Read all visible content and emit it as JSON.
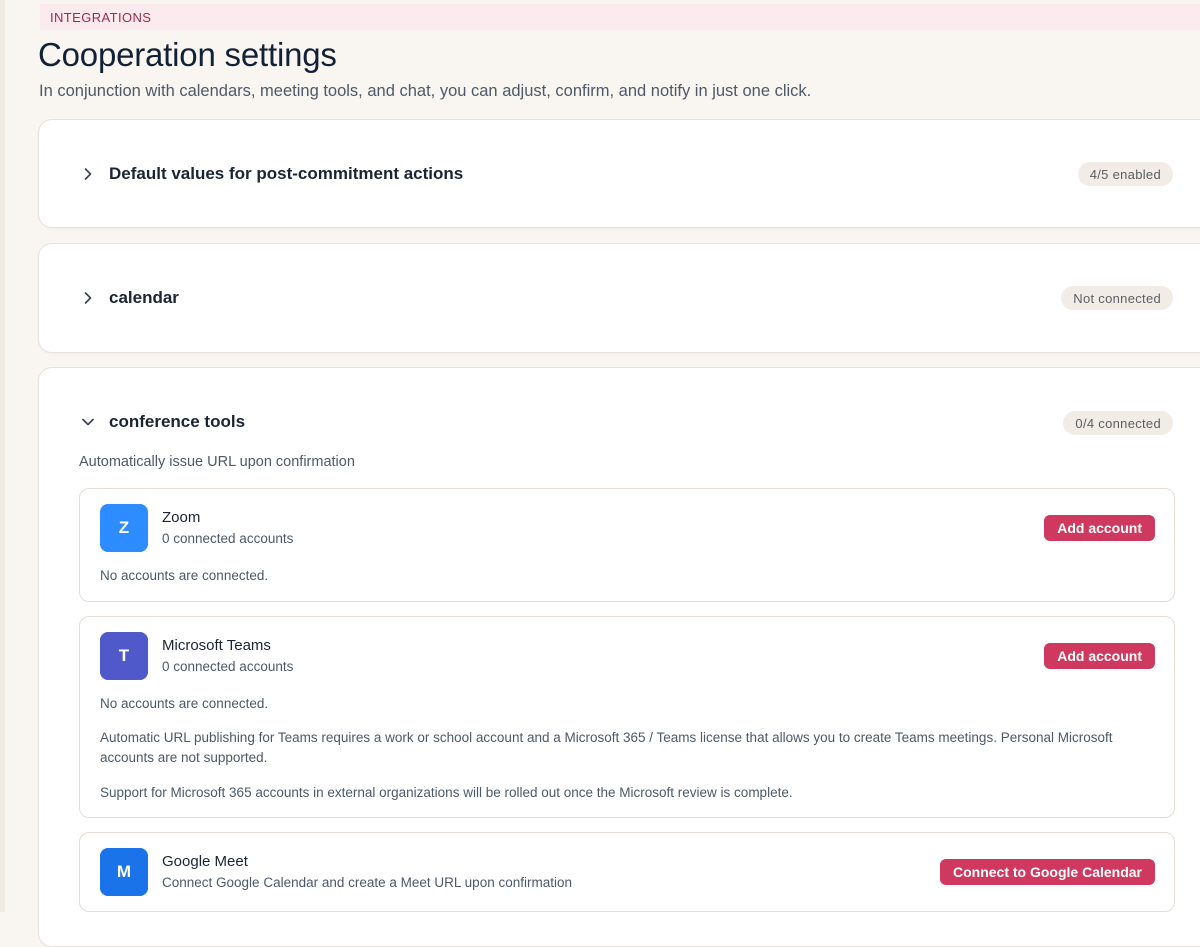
{
  "header": {
    "eyebrow": "INTEGRATIONS",
    "title": "Cooperation settings",
    "subtitle": "In conjunction with calendars, meeting tools, and chat, you can adjust, confirm, and notify in just one click."
  },
  "sections": [
    {
      "title": "Default values for post-commitment actions",
      "status": "4/5 enabled",
      "expanded": false
    },
    {
      "title": "calendar",
      "status": "Not connected",
      "expanded": false
    },
    {
      "title": "conference tools",
      "status": "0/4 connected",
      "expanded": true,
      "description": "Automatically issue URL upon confirmation",
      "tools": [
        {
          "icon_letter": "Z",
          "icon_color": "#2d8cff",
          "name": "Zoom",
          "subtitle": "0 connected accounts",
          "button": "Add account",
          "notes": [
            "No accounts are connected."
          ]
        },
        {
          "icon_letter": "T",
          "icon_color": "#5059c9",
          "name": "Microsoft Teams",
          "subtitle": "0 connected accounts",
          "button": "Add account",
          "notes": [
            "No accounts are connected.",
            "Automatic URL publishing for Teams requires a work or school account and a Microsoft 365 / Teams license that allows you to create Teams meetings. Personal Microsoft accounts are not supported.",
            "Support for Microsoft 365 accounts in external organizations will be rolled out once the Microsoft review is complete."
          ]
        },
        {
          "icon_letter": "M",
          "icon_color": "#1a73e8",
          "name": "Google Meet",
          "subtitle": "Connect Google Calendar and create a Meet URL upon confirmation",
          "button": "Connect to Google Calendar",
          "notes": []
        }
      ]
    }
  ],
  "colors": {
    "accent": "#d0395f",
    "eyebrow_text": "#a3284d",
    "eyebrow_bg": "#fcebee",
    "page_bg": "#f9f6f1"
  },
  "icons": {
    "collapsed": "chevron-right-icon",
    "expanded": "chevron-down-icon"
  }
}
